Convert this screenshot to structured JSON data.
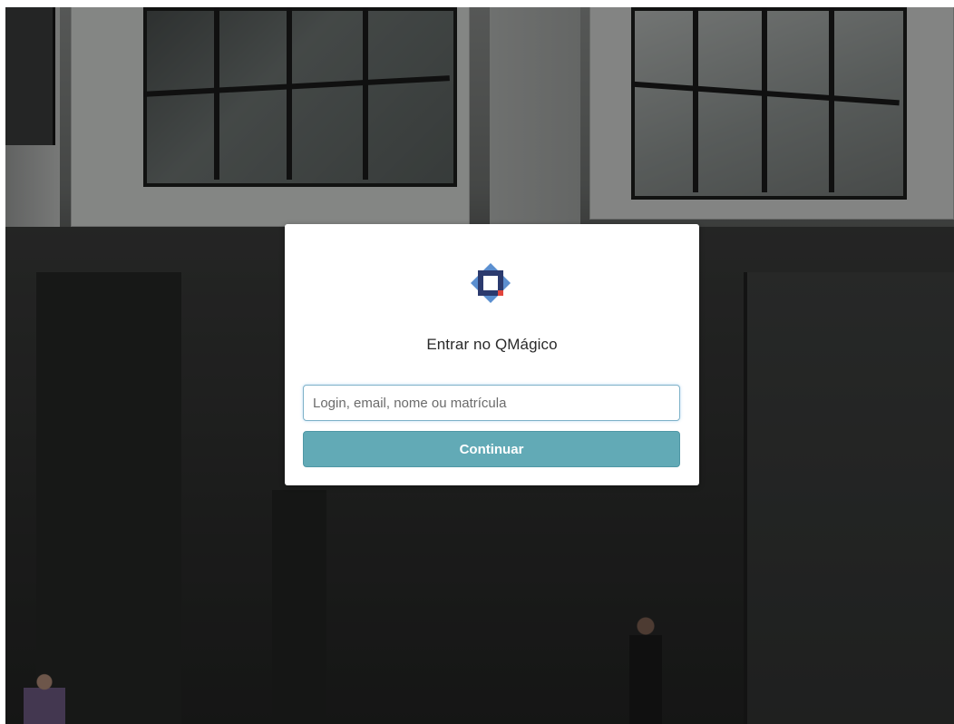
{
  "login": {
    "title": "Entrar no QMágico",
    "input_placeholder": "Login, email, nome ou matrícula",
    "input_value": "",
    "continue_label": "Continuar"
  },
  "logo": {
    "icon": "qmagico-logo-icon",
    "colors": {
      "diamond": "#5b8fd0",
      "square": "#2b3a6e",
      "accent": "#e2453c"
    }
  },
  "colors": {
    "button_bg": "#62aab6",
    "input_border": "#7fb2c8",
    "card_bg": "#ffffff"
  }
}
